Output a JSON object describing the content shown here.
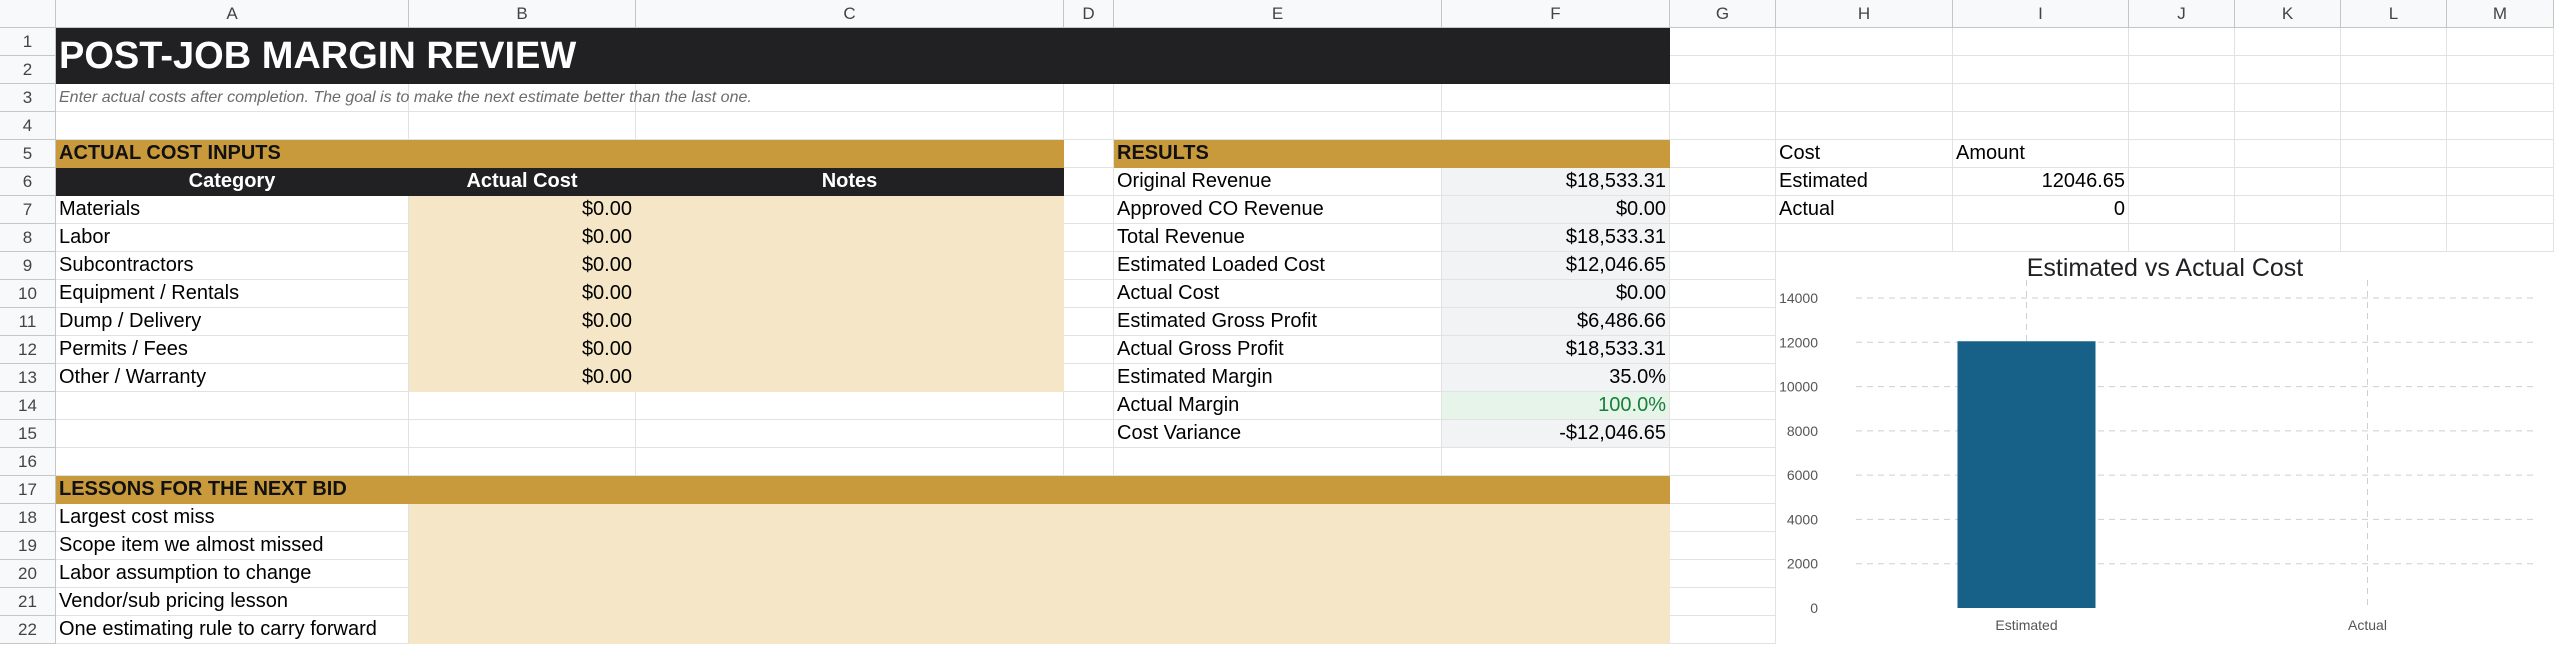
{
  "columns": [
    "A",
    "B",
    "C",
    "D",
    "E",
    "F",
    "G",
    "H",
    "I",
    "J",
    "K",
    "L",
    "M"
  ],
  "rows": [
    "1",
    "2",
    "3",
    "4",
    "5",
    "6",
    "7",
    "8",
    "9",
    "10",
    "11",
    "12",
    "13",
    "14",
    "15",
    "16",
    "17",
    "18",
    "19",
    "20",
    "21",
    "22"
  ],
  "sheet": {
    "title": "POST-JOB MARGIN REVIEW",
    "subtitle": "Enter actual costs after completion. The goal is to make the next estimate better than the last one.",
    "inputs_header": "ACTUAL COST INPUTS",
    "results_header": "RESULTS",
    "lessons_header": "LESSONS FOR THE NEXT BID",
    "table_headers": {
      "category": "Category",
      "actual_cost": "Actual Cost",
      "notes": "Notes"
    },
    "costs": [
      {
        "category": "Materials",
        "amount": "$0.00"
      },
      {
        "category": "Labor",
        "amount": "$0.00"
      },
      {
        "category": "Subcontractors",
        "amount": "$0.00"
      },
      {
        "category": "Equipment / Rentals",
        "amount": "$0.00"
      },
      {
        "category": "Dump / Delivery",
        "amount": "$0.00"
      },
      {
        "category": "Permits / Fees",
        "amount": "$0.00"
      },
      {
        "category": "Other / Warranty",
        "amount": "$0.00"
      }
    ],
    "results": [
      {
        "label": "Original Revenue",
        "value": "$18,533.31"
      },
      {
        "label": "Approved CO Revenue",
        "value": "$0.00"
      },
      {
        "label": "Total Revenue",
        "value": "$18,533.31"
      },
      {
        "label": "Estimated Loaded Cost",
        "value": "$12,046.65"
      },
      {
        "label": "Actual Cost",
        "value": "$0.00"
      },
      {
        "label": "Estimated Gross Profit",
        "value": "$6,486.66"
      },
      {
        "label": "Actual Gross Profit",
        "value": "$18,533.31"
      },
      {
        "label": "Estimated Margin",
        "value": "35.0%"
      },
      {
        "label": "Actual Margin",
        "value": "100.0%"
      },
      {
        "label": "Cost Variance",
        "value": "-$12,046.65"
      }
    ],
    "lessons": [
      "Largest cost miss",
      "Scope item we almost missed",
      "Labor assumption to change",
      "Vendor/sub pricing lesson",
      "One estimating rule to carry forward"
    ],
    "helper": {
      "header_cost": "Cost",
      "header_amount": "Amount",
      "rows": [
        {
          "label": "Estimated",
          "value": "12046.65"
        },
        {
          "label": "Actual",
          "value": "0"
        }
      ]
    }
  },
  "colors": {
    "title_bg": "#212124",
    "section_gold": "#c89a3c",
    "input_fill": "#f4e6c6",
    "bar": "#176087",
    "positive_green": "#188038"
  },
  "chart_data": {
    "type": "bar",
    "title": "Estimated vs Actual Cost",
    "categories": [
      "Estimated",
      "Actual"
    ],
    "values": [
      12046.65,
      0
    ],
    "ylim": [
      0,
      14000
    ],
    "yticks": [
      "0",
      "2000",
      "4000",
      "6000",
      "8000",
      "10000",
      "12000",
      "14000"
    ],
    "grid": true,
    "legend": "none"
  }
}
